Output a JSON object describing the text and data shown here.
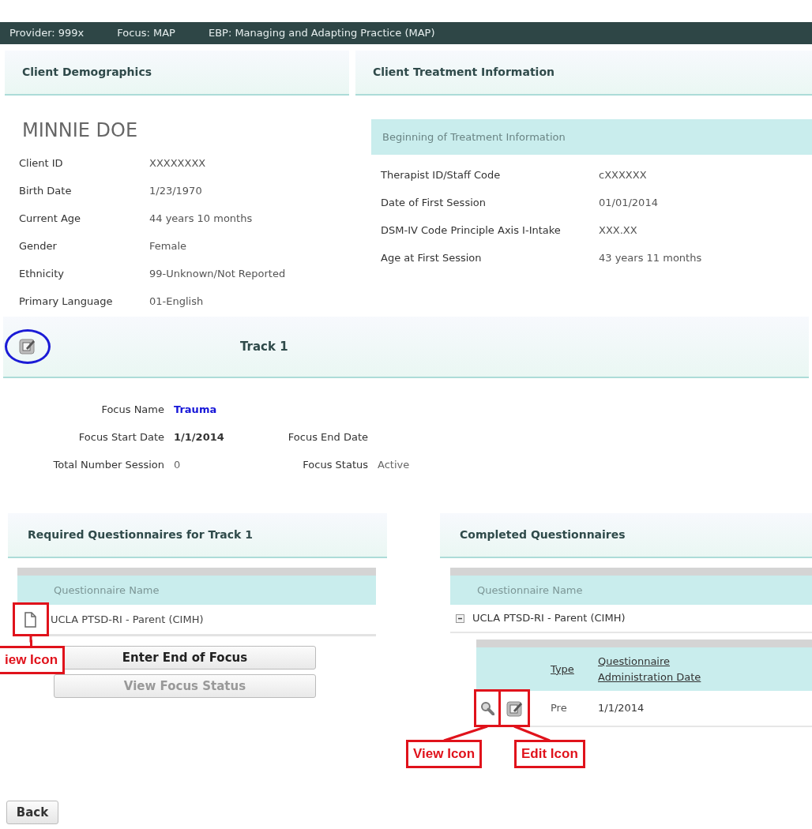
{
  "top_bar": {
    "items": [
      "Provider: 999x",
      "Focus: MAP",
      "EBP: Managing and Adapting Practice (MAP)"
    ]
  },
  "demographics": {
    "title": "Client Demographics",
    "client_name": "MINNIE DOE",
    "fields": [
      {
        "label": "Client ID",
        "value": "XXXXXXXX"
      },
      {
        "label": "Birth Date",
        "value": "1/23/1970"
      },
      {
        "label": "Current Age",
        "value": "44 years 10 months"
      },
      {
        "label": "Gender",
        "value": "Female"
      },
      {
        "label": "Ethnicity",
        "value": "99-Unknown/Not Reported"
      },
      {
        "label": "Primary Language",
        "value": "01-English"
      }
    ]
  },
  "treatment": {
    "title": "Client Treatment Information",
    "subheader": "Beginning of Treatment Information",
    "fields": [
      {
        "label": "Therapist ID/Staff Code",
        "value": "cXXXXXX"
      },
      {
        "label": "Date of First Session",
        "value": "01/01/2014"
      },
      {
        "label": "DSM-IV Code Principle Axis I-Intake",
        "value": "XXX.XX"
      },
      {
        "label": "Age at First Session",
        "value": "43 years 11 months"
      }
    ]
  },
  "track": {
    "title": "Track 1",
    "edit_icon_circled": true,
    "focus_rows": [
      [
        {
          "label": "Focus Name",
          "value": "Trauma",
          "kind": "link"
        }
      ],
      [
        {
          "label": "Focus Start Date",
          "value": "1/1/2014",
          "kind": "bold"
        },
        {
          "label": "Focus End Date"
        }
      ],
      [
        {
          "label": "Total Number Session",
          "value": "0",
          "kind": "plain"
        },
        {
          "label": "Focus Status",
          "value": "Active",
          "kind": "plain"
        }
      ]
    ]
  },
  "required": {
    "title": "Required Questionnaires for Track 1",
    "column": "Questionnaire Name",
    "rows": [
      {
        "name": "UCLA PTSD-RI - Parent (CIMH)",
        "callout": "iew Icon"
      }
    ],
    "buttons": [
      {
        "label": "Enter End of Focus",
        "disabled": false
      },
      {
        "label": "View Focus Status",
        "disabled": true
      }
    ]
  },
  "completed": {
    "title": "Completed Questionnaires",
    "column": "Questionnaire Name",
    "rows": [
      {
        "name": "UCLA PTSD-RI - Parent (CIMH)",
        "expanded": true,
        "sub_columns": [
          "Type",
          "Questionnaire Administration Date"
        ],
        "sub_rows": [
          {
            "type": "Pre",
            "date": "1/1/2014",
            "view_callout": "View Icon",
            "edit_callout": "Edit Icon"
          }
        ]
      }
    ]
  },
  "back_button": "Back"
}
